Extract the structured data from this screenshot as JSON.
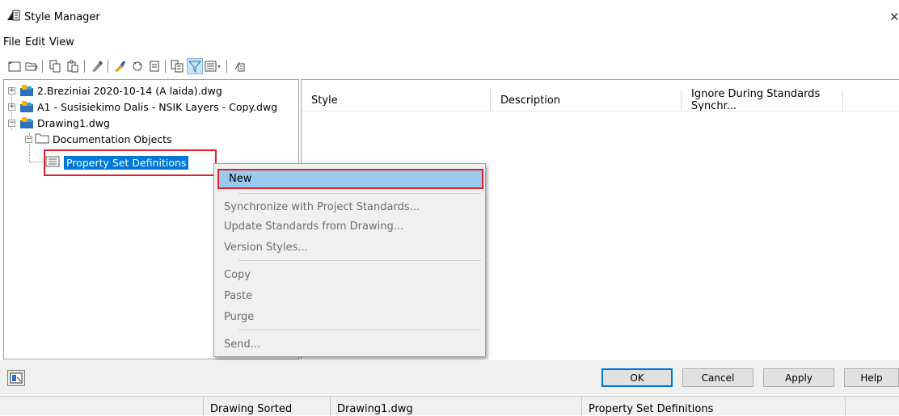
{
  "window": {
    "title": "Style Manager",
    "close_glyph": "✕",
    "icon": "style-manager-icon"
  },
  "menu": {
    "items": [
      "File",
      "Edit",
      "View"
    ]
  },
  "toolbar": {
    "icons": [
      "new-drawing-icon",
      "open-drawing-icon",
      "copy-icon",
      "paste-icon",
      "edit-style-icon",
      "purge-icon",
      "synchronize-icon",
      "send-icon",
      "toggle-view-icon",
      "filter-icon",
      "view-options-icon",
      "inspect-icon"
    ],
    "active": "filter-icon"
  },
  "tree": {
    "nodes": [
      {
        "label": "2.Breziniai 2020-10-14 (A laida).dwg",
        "expander": "+"
      },
      {
        "label": "A1 - Susisiekimo Dalis - NSIK Layers - Copy.dwg",
        "expander": "+"
      },
      {
        "label": "Drawing1.dwg",
        "expander": "−"
      },
      {
        "label": "Documentation Objects",
        "expander": "−"
      },
      {
        "label": "Property Set Definitions",
        "selected": true
      }
    ]
  },
  "list": {
    "columns": [
      "Style",
      "Description",
      "Ignore During Standards Synchr..."
    ]
  },
  "context_menu": {
    "highlighted": "New",
    "items": [
      {
        "label": "Synchronize with Project Standards...",
        "enabled": false
      },
      {
        "label": "Update Standards from Drawing...",
        "enabled": false
      },
      {
        "label": "Version Styles...",
        "enabled": false
      },
      {
        "label": "Copy",
        "enabled": false
      },
      {
        "label": "Paste",
        "enabled": false
      },
      {
        "label": "Purge",
        "enabled": false
      },
      {
        "label": "Send...",
        "enabled": false
      }
    ]
  },
  "buttons": {
    "ok": "OK",
    "cancel": "Cancel",
    "apply": "Apply",
    "help": "Help"
  },
  "status": {
    "sort": "Drawing Sorted",
    "drawing": "Drawing1.dwg",
    "selection": "Property Set Definitions"
  },
  "colors": {
    "selection": "#0078d7",
    "menu_highlight": "#99c9ef",
    "annotation": "#e0202a"
  }
}
